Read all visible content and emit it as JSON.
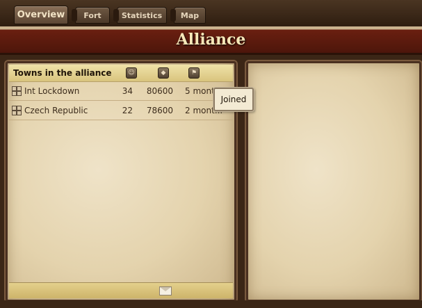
{
  "tabs": [
    {
      "label": "Overview",
      "active": true
    },
    {
      "label": "Fort",
      "active": false
    },
    {
      "label": "Statistics",
      "active": false
    },
    {
      "label": "Map",
      "active": false
    }
  ],
  "page_title": "Alliance",
  "towns_list": {
    "header": "Towns in the alliance",
    "column_icons": [
      "members-icon",
      "points-icon",
      "joined-icon"
    ],
    "rows": [
      {
        "name": "Int Lockdown",
        "members": "34",
        "points": "80600",
        "joined": "5 mont..."
      },
      {
        "name": "Czech Republic",
        "members": "22",
        "points": "78600",
        "joined": "2 mont..."
      }
    ],
    "footer_icon": "envelope-icon"
  },
  "tooltip": {
    "text": "Joined"
  },
  "colors": {
    "title_bar": "#4d160b",
    "title_text": "#f7e7b8",
    "parchment": "#e4d3ad",
    "frame": "#4a3020"
  }
}
